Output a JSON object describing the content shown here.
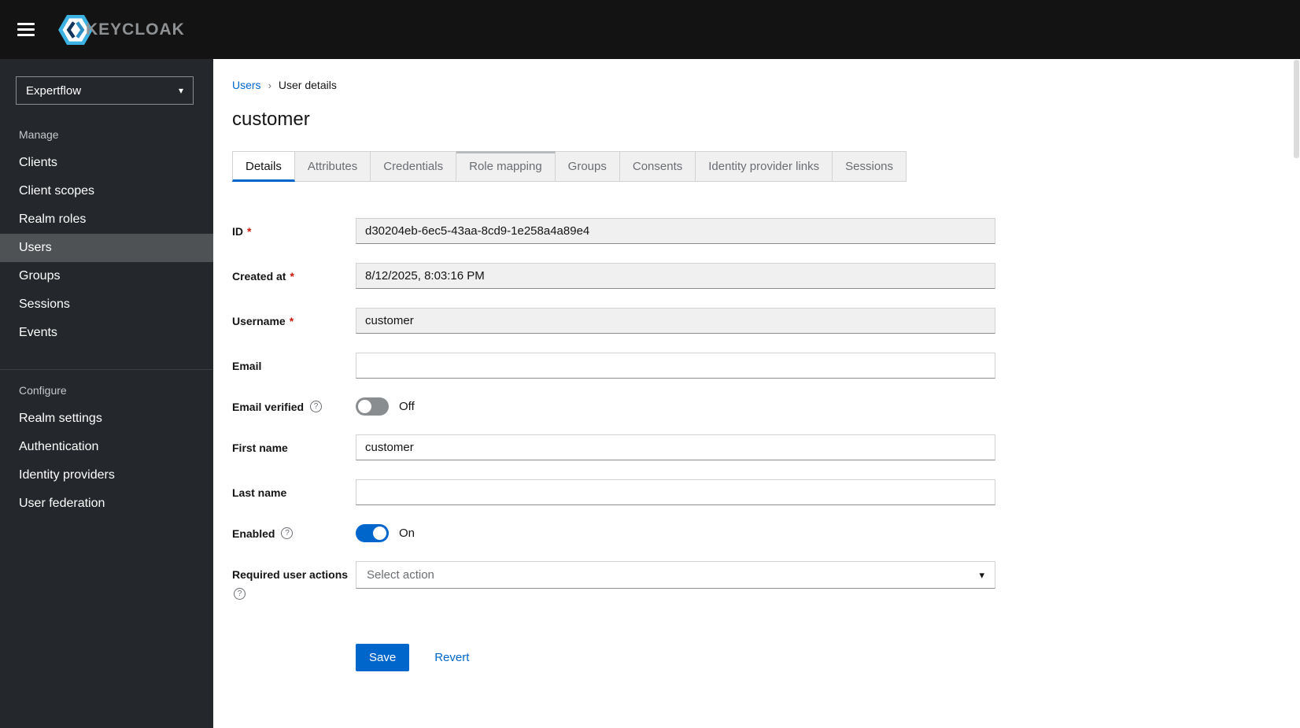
{
  "masthead": {
    "brand": "KEYCLOAK"
  },
  "icons": {
    "chevron_down": "▾",
    "breadcrumb_separator": "›",
    "help": "?",
    "select_caret": "▾"
  },
  "sidebar": {
    "realm": "Expertflow",
    "sections": [
      {
        "label": "Manage",
        "items": [
          {
            "label": "Clients",
            "active": false
          },
          {
            "label": "Client scopes",
            "active": false
          },
          {
            "label": "Realm roles",
            "active": false
          },
          {
            "label": "Users",
            "active": true
          },
          {
            "label": "Groups",
            "active": false
          },
          {
            "label": "Sessions",
            "active": false
          },
          {
            "label": "Events",
            "active": false
          }
        ]
      },
      {
        "label": "Configure",
        "items": [
          {
            "label": "Realm settings",
            "active": false
          },
          {
            "label": "Authentication",
            "active": false
          },
          {
            "label": "Identity providers",
            "active": false
          },
          {
            "label": "User federation",
            "active": false
          }
        ]
      }
    ]
  },
  "breadcrumb": {
    "link": "Users",
    "current": "User details"
  },
  "page": {
    "title": "customer"
  },
  "tabs": [
    {
      "label": "Details",
      "active": true
    },
    {
      "label": "Attributes",
      "active": false
    },
    {
      "label": "Credentials",
      "active": false
    },
    {
      "label": "Role mapping",
      "active": false
    },
    {
      "label": "Groups",
      "active": false
    },
    {
      "label": "Consents",
      "active": false
    },
    {
      "label": "Identity provider links",
      "active": false
    },
    {
      "label": "Sessions",
      "active": false
    }
  ],
  "form": {
    "id": {
      "label": "ID",
      "required": "*",
      "value": "d30204eb-6ec5-43aa-8cd9-1e258a4a89e4"
    },
    "created_at": {
      "label": "Created at",
      "required": "*",
      "value": "8/12/2025, 8:03:16 PM"
    },
    "username": {
      "label": "Username",
      "required": "*",
      "value": "customer"
    },
    "email": {
      "label": "Email",
      "value": ""
    },
    "email_verified": {
      "label": "Email verified",
      "state": "Off"
    },
    "first_name": {
      "label": "First name",
      "value": "customer"
    },
    "last_name": {
      "label": "Last name",
      "value": ""
    },
    "enabled": {
      "label": "Enabled",
      "state": "On"
    },
    "required_user_actions": {
      "label": "Required user actions",
      "placeholder": "Select action"
    }
  },
  "actions": {
    "save": "Save",
    "revert": "Revert"
  },
  "colors": {
    "accent": "#0066cc",
    "danger": "#c9190b",
    "masthead_bg": "#131313",
    "sidebar_bg": "#24272b",
    "sidebar_active_bg": "#4f5255",
    "readonly_bg": "#f0f0f0",
    "tab_inactive_bg": "#f0f0f0",
    "logo_blue": "#3cb2e3"
  }
}
